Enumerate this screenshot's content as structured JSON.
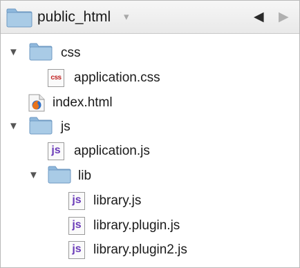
{
  "header": {
    "title": "public_html",
    "dropdown_glyph": "▾",
    "back_glyph": "◀",
    "forward_glyph": "▶"
  },
  "tree": {
    "expanded_glyph": "▼",
    "items": [
      {
        "label": "css",
        "type": "folder",
        "expanded": true,
        "depth": 0
      },
      {
        "label": "application.css",
        "type": "file",
        "icon": "css",
        "icon_text": "css",
        "depth": 1
      },
      {
        "label": "index.html",
        "type": "file",
        "icon": "html",
        "depth": 0
      },
      {
        "label": "js",
        "type": "folder",
        "expanded": true,
        "depth": 0
      },
      {
        "label": "application.js",
        "type": "file",
        "icon": "js",
        "icon_text": "js",
        "depth": 1
      },
      {
        "label": "lib",
        "type": "folder",
        "expanded": true,
        "depth": 1
      },
      {
        "label": "library.js",
        "type": "file",
        "icon": "js",
        "icon_text": "js",
        "depth": 2
      },
      {
        "label": "library.plugin.js",
        "type": "file",
        "icon": "js",
        "icon_text": "js",
        "depth": 2
      },
      {
        "label": "library.plugin2.js",
        "type": "file",
        "icon": "js",
        "icon_text": "js",
        "depth": 2
      }
    ]
  },
  "colors": {
    "folder_body": "#a9cbe6",
    "folder_tab": "#8fb8dc",
    "js_text": "#6a3bb8",
    "css_text": "#c02020"
  }
}
